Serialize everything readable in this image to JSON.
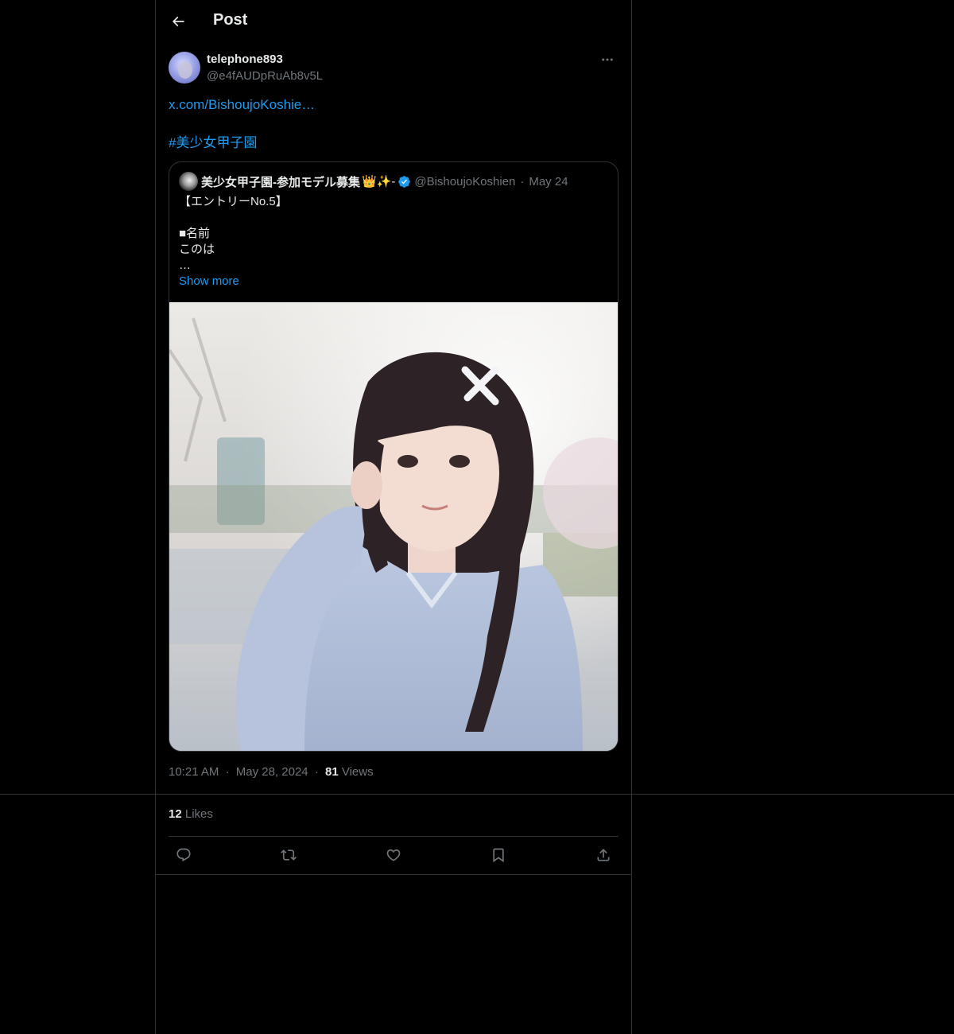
{
  "header": {
    "title": "Post"
  },
  "author": {
    "display_name": "telephone893",
    "handle": "@e4fAUDpRuAb8v5L"
  },
  "tweet": {
    "link_text": "x.com/BishoujoKoshie…",
    "hashtag": "#美少女甲子園"
  },
  "quote": {
    "name": "美少女甲子園-参加モデル募集",
    "emoji": "👑✨-",
    "handle": "@BishoujoKoshien",
    "separator": "·",
    "date": "May 24",
    "lines": [
      "【エントリーNo.5】",
      "",
      "■名前",
      "このは",
      "…"
    ],
    "show_more": "Show more"
  },
  "meta": {
    "time": "10:21 AM",
    "separator": "·",
    "date": "May 28, 2024",
    "views_count": "81",
    "views_label": "Views"
  },
  "stats": {
    "likes_count": "12",
    "likes_label": "Likes"
  },
  "icons": {
    "back": "arrow-left-icon",
    "more": "more-horizontal-icon",
    "verified": "verified-badge-icon",
    "reply": "reply-icon",
    "repost": "repost-icon",
    "like": "heart-icon",
    "bookmark": "bookmark-icon",
    "share": "share-icon"
  },
  "colors": {
    "background": "#000000",
    "accent": "#1d9bf0",
    "text": "#e7e9ea",
    "muted": "#71767b",
    "border": "#2f3336"
  }
}
